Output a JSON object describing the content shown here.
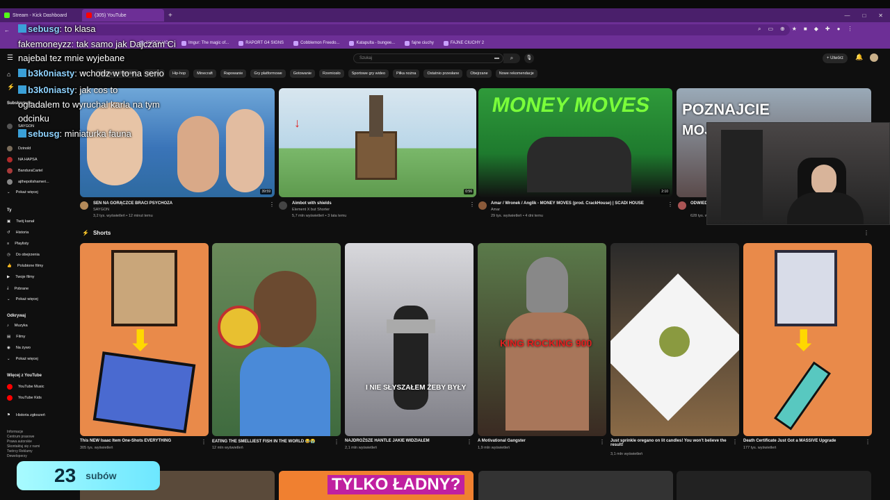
{
  "browser": {
    "tabs": [
      {
        "label": "Stream - Kick Dashboard",
        "active": false
      },
      {
        "label": "(305) YouTube",
        "active": true
      }
    ],
    "bookmarks": [
      "KHOCK HO...",
      "Imgur: The magic of...",
      "RAPORT G4 SIGNS",
      "Cobblemon Freedo...",
      "Katapulta - bungee...",
      "fajne ciuchy",
      "FAJNE CIUCHY 2"
    ]
  },
  "youtube": {
    "search_placeholder": "Szukaj",
    "create_label": "+ Utwórz",
    "chips": [
      "Playlisty YouTube Mix",
      "Na żywo",
      "Hip-hop",
      "Minecraft",
      "Rapowanie",
      "Gry platformowe",
      "Gotowanie",
      "Rzemiosło",
      "Sportowe gry wideo",
      "Piłka nożna",
      "Ostatnio przesłane",
      "Obejrzane",
      "Nowe rekomendacje"
    ],
    "sidebar": {
      "subs_header": "Subskrypcje",
      "subs": [
        "SAYGON",
        "Dzinold",
        "NA HAPSA",
        "BandurаCartel",
        "ajthepolishameri...",
        "Pokaż więcej"
      ],
      "you_header": "Ty",
      "you": [
        "Twój kanał",
        "Historia",
        "Playlisty",
        "Do obejrzenia",
        "Polubione filmy",
        "Twoje filmy",
        "Pobrane",
        "Pokaż więcej"
      ],
      "explore_header": "Odkrywaj",
      "explore": [
        "Muzyka",
        "Filmy",
        "Na żywo",
        "Pokaż więcej"
      ],
      "more_header": "Więcej z YouTube",
      "more": [
        "YouTube Music",
        "YouTube Kids"
      ],
      "history_report": "Historia zgłoszeń",
      "footer": [
        "Informacje",
        "Centrum prasowe",
        "Prawa autorskie",
        "Skontaktuj się z nami",
        "Twórcy  Reklamy",
        "Deweloperzy"
      ]
    },
    "videos": [
      {
        "title": "SEN NA GORĄCZCE BRACI PSYCHOZA",
        "channel": "SAYGON",
        "meta": "3,2 tys. wyświetleń • 12 minut temu",
        "duration": "39:59",
        "color": "#3a74b8"
      },
      {
        "title": "Aimbot with shields",
        "channel": "Element X but Shorter",
        "meta": "5,7 mln wyświetleń • 3 lata temu",
        "duration": "0:56",
        "color": "#7ab86a"
      },
      {
        "title": "Amar / Wronek / Anglik - MONEY MOVES (prod. CrackHouse) | SCADI HOUSE",
        "channel": "Amar",
        "meta": "29 tys. wyświetleń • 4 dni temu",
        "duration": "2:10",
        "color": "#1e7a2e"
      },
      {
        "title": "ODWIEDZ...",
        "channel": "",
        "meta": "628 tys. w...",
        "duration": "",
        "color": "#5a4a4a"
      }
    ],
    "video_text": [
      "POZNAJCIE",
      "MOJ"
    ],
    "shorts_label": "Shorts",
    "shorts": [
      {
        "title": "This NEW Isaac Item One-Shots EVERYTHING",
        "meta": "305 tys. wyświetleń",
        "color": "#e98a4a"
      },
      {
        "title": "EATING THE SMELLIEST FISH IN THE WORLD 😂😭",
        "meta": "12 mln wyświetleń",
        "color": "#3f6b3f"
      },
      {
        "title": "NAJDROŻSZE HANTLE JAKIE WIDZIAŁEM",
        "meta": "2,1 mln wyświetleń",
        "color": "#7e7e86",
        "overlay": "I NIE SŁYSZAŁEM ŻEBY BYŁY"
      },
      {
        "title": "A Motivational Gangster",
        "meta": "1,9 mln wyświetleń",
        "color": "#5a4233",
        "overlay": "KING ROCKING 900"
      },
      {
        "title": "Just sprinkle oregano on lit candles! You won't believe the result!",
        "meta": "3,1 mln wyświetleń",
        "color": "#8a6a46"
      },
      {
        "title": "Death Certificate Just Got a MASSIVE Upgrade",
        "meta": "177 tys. wyświetleń",
        "color": "#e98a4a"
      }
    ],
    "bottom_text": "TYLKO ŁADNY?"
  },
  "chat": [
    {
      "user": "sebusg",
      "text": ": to klasa"
    },
    {
      "user": "",
      "text": "fakemoneyzz: tak samo jak Dajczam Ci"
    },
    {
      "user": "",
      "text": "najebal tez mnie wyjebane"
    },
    {
      "user": "b3k0niasty",
      "text": ": wchodz w to na serio"
    },
    {
      "user": "b3k0niasty",
      "text": ": jak cos to"
    },
    {
      "user": "",
      "text": "ogladalem to     wyruchal karla na tym"
    },
    {
      "user": "",
      "text": "odcinku"
    },
    {
      "user": "sebusg",
      "text": ": miniaturka fauna"
    }
  ],
  "subs_counter": {
    "value": "23",
    "label": "subów"
  }
}
